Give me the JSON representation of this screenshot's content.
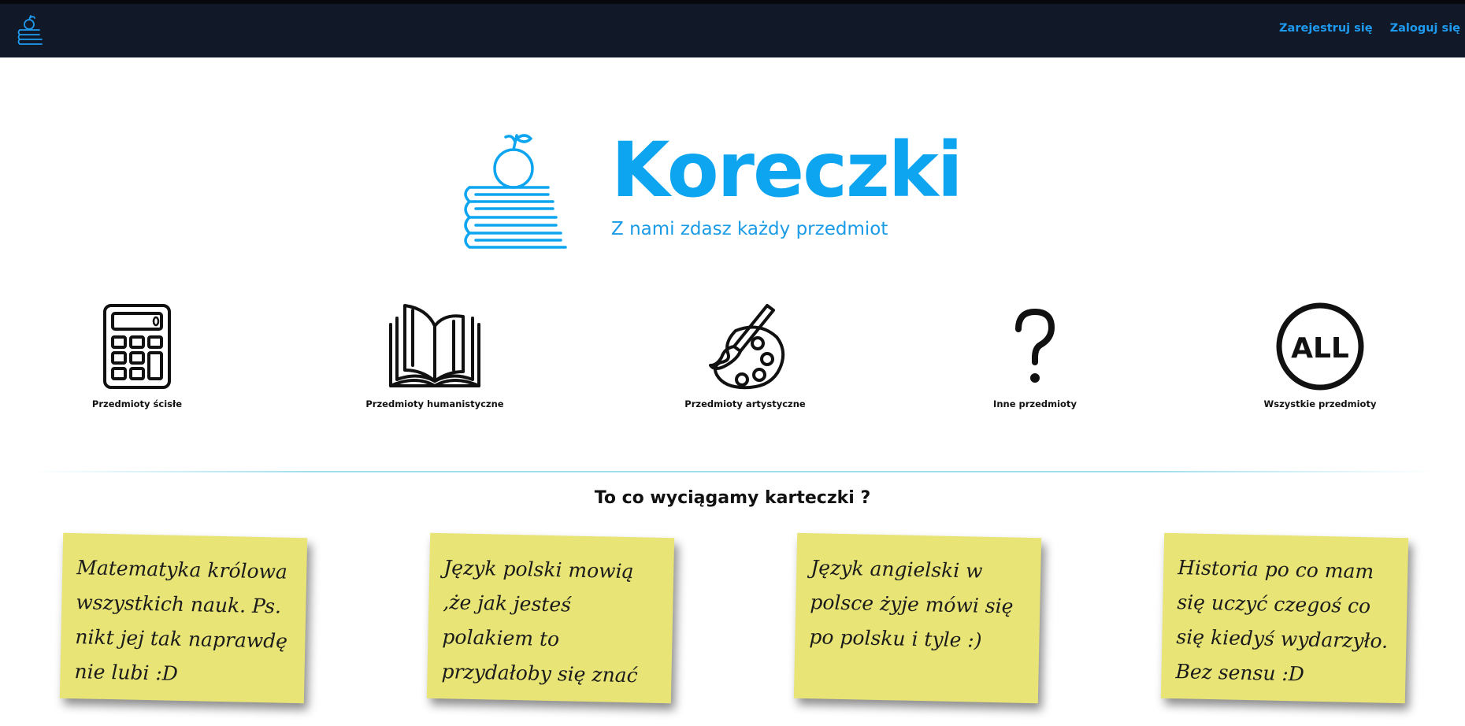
{
  "navbar": {
    "logo_icon": "books-apple-icon",
    "register_label": "Zarejestruj się",
    "login_label": "Zaloguj się"
  },
  "hero": {
    "title": "Koreczki",
    "subtitle": "Z nami zdasz każdy przedmiot",
    "icon": "books-apple-icon",
    "accent_color": "#0ea5f0"
  },
  "categories": [
    {
      "label": "Przedmioty ścisłe",
      "icon": "calculator-icon"
    },
    {
      "label": "Przedmioty humanistyczne",
      "icon": "open-book-icon"
    },
    {
      "label": "Przedmioty artystyczne",
      "icon": "palette-icon"
    },
    {
      "label": "Inne przedmioty",
      "icon": "question-mark-icon"
    },
    {
      "label": "Wszystkie przedmioty",
      "icon": "all-circle-icon",
      "icon_text": "ALL"
    }
  ],
  "section": {
    "title": "To co wyciągamy karteczki ?"
  },
  "notes": [
    {
      "text": "Matematyka królowa wszystkich nauk. Ps. nikt jej tak naprawdę nie lubi :D"
    },
    {
      "text": "Język polski mowią ,że jak jesteś polakiem to przydałoby się znać"
    },
    {
      "text": "Język angielski w polsce żyje mówi się po polsku i tyle :)"
    },
    {
      "text": "Historia po co mam się uczyć czegoś co się kiedyś wydarzyło. Bez sensu :D"
    }
  ],
  "colors": {
    "navbar_bg": "#111827",
    "link": "#1e9bf0",
    "note_bg": "#e8e576"
  }
}
